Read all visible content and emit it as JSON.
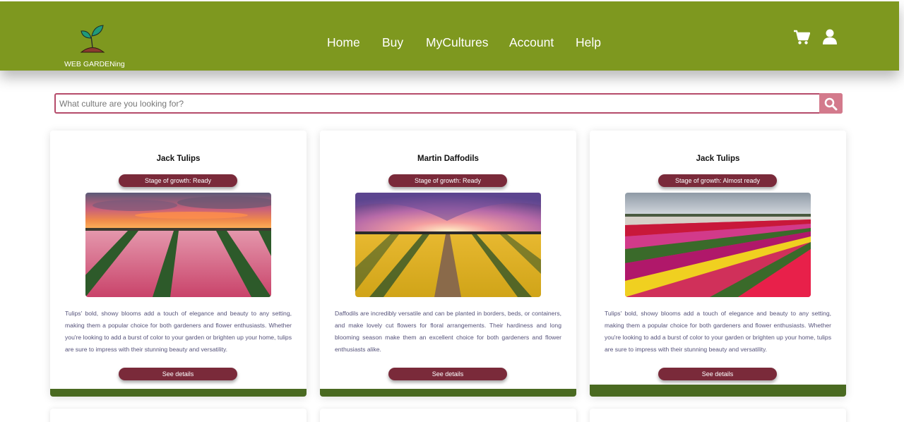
{
  "brand": {
    "logo_text": "WEB GARDENing"
  },
  "nav": {
    "items": [
      {
        "label": "Home"
      },
      {
        "label": "Buy"
      },
      {
        "label": "MyCultures"
      },
      {
        "label": "Account"
      },
      {
        "label": "Help"
      }
    ]
  },
  "header_icons": {
    "cart": "cart-icon",
    "account": "user-icon"
  },
  "search": {
    "placeholder": "What culture are you looking for?",
    "value": "",
    "button_icon": "search-icon"
  },
  "cards": [
    {
      "title": "Jack Tulips",
      "stage": "Stage of growth: Ready",
      "image": "pink tulip field at sunset",
      "description": "Tulips' bold, showy blooms add a touch of elegance and beauty to any setting, making them a popular choice for both gardeners and flower enthusiasts. Whether you're looking to add a burst of color to your garden or brighten up your home, tulips are sure to impress with their stunning beauty and versatility.",
      "button": "See details"
    },
    {
      "title": "Martin Daffodils",
      "stage": "Stage of growth: Ready",
      "image": "yellow daffodil field at sunset",
      "description": "Daffodils are incredibly versatile and can be planted in borders, beds, or containers, and make lovely cut flowers for floral arrangements. Their hardiness and long blooming season make them an excellent choice for both gardeners and flower enthusiasts alike.",
      "button": "See details"
    },
    {
      "title": "Jack Tulips",
      "stage": "Stage of growth: Almost ready",
      "image": "striped tulip field yellow red pink",
      "description": "Tulips' bold, showy blooms add a touch of elegance and beauty to any setting, making them a popular choice for both gardeners and flower enthusiasts. Whether you're looking to add a burst of color to your garden or brighten up your home, tulips are sure to impress with their stunning beauty and versatility.",
      "button": "See details"
    }
  ],
  "colors": {
    "header": "#7e981f",
    "accent": "#7a2a3a",
    "search_border": "#b54b6a",
    "search_button": "#d37a8c",
    "card_footer": "#4a6a21",
    "description_text": "#55527a"
  }
}
